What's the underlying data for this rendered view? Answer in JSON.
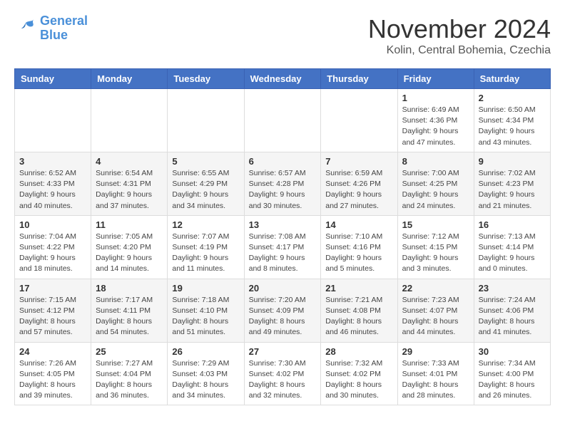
{
  "header": {
    "logo_line1": "General",
    "logo_line2": "Blue",
    "month": "November 2024",
    "location": "Kolin, Central Bohemia, Czechia"
  },
  "days_of_week": [
    "Sunday",
    "Monday",
    "Tuesday",
    "Wednesday",
    "Thursday",
    "Friday",
    "Saturday"
  ],
  "weeks": [
    [
      {
        "day": "",
        "info": ""
      },
      {
        "day": "",
        "info": ""
      },
      {
        "day": "",
        "info": ""
      },
      {
        "day": "",
        "info": ""
      },
      {
        "day": "",
        "info": ""
      },
      {
        "day": "1",
        "info": "Sunrise: 6:49 AM\nSunset: 4:36 PM\nDaylight: 9 hours\nand 47 minutes."
      },
      {
        "day": "2",
        "info": "Sunrise: 6:50 AM\nSunset: 4:34 PM\nDaylight: 9 hours\nand 43 minutes."
      }
    ],
    [
      {
        "day": "3",
        "info": "Sunrise: 6:52 AM\nSunset: 4:33 PM\nDaylight: 9 hours\nand 40 minutes."
      },
      {
        "day": "4",
        "info": "Sunrise: 6:54 AM\nSunset: 4:31 PM\nDaylight: 9 hours\nand 37 minutes."
      },
      {
        "day": "5",
        "info": "Sunrise: 6:55 AM\nSunset: 4:29 PM\nDaylight: 9 hours\nand 34 minutes."
      },
      {
        "day": "6",
        "info": "Sunrise: 6:57 AM\nSunset: 4:28 PM\nDaylight: 9 hours\nand 30 minutes."
      },
      {
        "day": "7",
        "info": "Sunrise: 6:59 AM\nSunset: 4:26 PM\nDaylight: 9 hours\nand 27 minutes."
      },
      {
        "day": "8",
        "info": "Sunrise: 7:00 AM\nSunset: 4:25 PM\nDaylight: 9 hours\nand 24 minutes."
      },
      {
        "day": "9",
        "info": "Sunrise: 7:02 AM\nSunset: 4:23 PM\nDaylight: 9 hours\nand 21 minutes."
      }
    ],
    [
      {
        "day": "10",
        "info": "Sunrise: 7:04 AM\nSunset: 4:22 PM\nDaylight: 9 hours\nand 18 minutes."
      },
      {
        "day": "11",
        "info": "Sunrise: 7:05 AM\nSunset: 4:20 PM\nDaylight: 9 hours\nand 14 minutes."
      },
      {
        "day": "12",
        "info": "Sunrise: 7:07 AM\nSunset: 4:19 PM\nDaylight: 9 hours\nand 11 minutes."
      },
      {
        "day": "13",
        "info": "Sunrise: 7:08 AM\nSunset: 4:17 PM\nDaylight: 9 hours\nand 8 minutes."
      },
      {
        "day": "14",
        "info": "Sunrise: 7:10 AM\nSunset: 4:16 PM\nDaylight: 9 hours\nand 5 minutes."
      },
      {
        "day": "15",
        "info": "Sunrise: 7:12 AM\nSunset: 4:15 PM\nDaylight: 9 hours\nand 3 minutes."
      },
      {
        "day": "16",
        "info": "Sunrise: 7:13 AM\nSunset: 4:14 PM\nDaylight: 9 hours\nand 0 minutes."
      }
    ],
    [
      {
        "day": "17",
        "info": "Sunrise: 7:15 AM\nSunset: 4:12 PM\nDaylight: 8 hours\nand 57 minutes."
      },
      {
        "day": "18",
        "info": "Sunrise: 7:17 AM\nSunset: 4:11 PM\nDaylight: 8 hours\nand 54 minutes."
      },
      {
        "day": "19",
        "info": "Sunrise: 7:18 AM\nSunset: 4:10 PM\nDaylight: 8 hours\nand 51 minutes."
      },
      {
        "day": "20",
        "info": "Sunrise: 7:20 AM\nSunset: 4:09 PM\nDaylight: 8 hours\nand 49 minutes."
      },
      {
        "day": "21",
        "info": "Sunrise: 7:21 AM\nSunset: 4:08 PM\nDaylight: 8 hours\nand 46 minutes."
      },
      {
        "day": "22",
        "info": "Sunrise: 7:23 AM\nSunset: 4:07 PM\nDaylight: 8 hours\nand 44 minutes."
      },
      {
        "day": "23",
        "info": "Sunrise: 7:24 AM\nSunset: 4:06 PM\nDaylight: 8 hours\nand 41 minutes."
      }
    ],
    [
      {
        "day": "24",
        "info": "Sunrise: 7:26 AM\nSunset: 4:05 PM\nDaylight: 8 hours\nand 39 minutes."
      },
      {
        "day": "25",
        "info": "Sunrise: 7:27 AM\nSunset: 4:04 PM\nDaylight: 8 hours\nand 36 minutes."
      },
      {
        "day": "26",
        "info": "Sunrise: 7:29 AM\nSunset: 4:03 PM\nDaylight: 8 hours\nand 34 minutes."
      },
      {
        "day": "27",
        "info": "Sunrise: 7:30 AM\nSunset: 4:02 PM\nDaylight: 8 hours\nand 32 minutes."
      },
      {
        "day": "28",
        "info": "Sunrise: 7:32 AM\nSunset: 4:02 PM\nDaylight: 8 hours\nand 30 minutes."
      },
      {
        "day": "29",
        "info": "Sunrise: 7:33 AM\nSunset: 4:01 PM\nDaylight: 8 hours\nand 28 minutes."
      },
      {
        "day": "30",
        "info": "Sunrise: 7:34 AM\nSunset: 4:00 PM\nDaylight: 8 hours\nand 26 minutes."
      }
    ]
  ]
}
